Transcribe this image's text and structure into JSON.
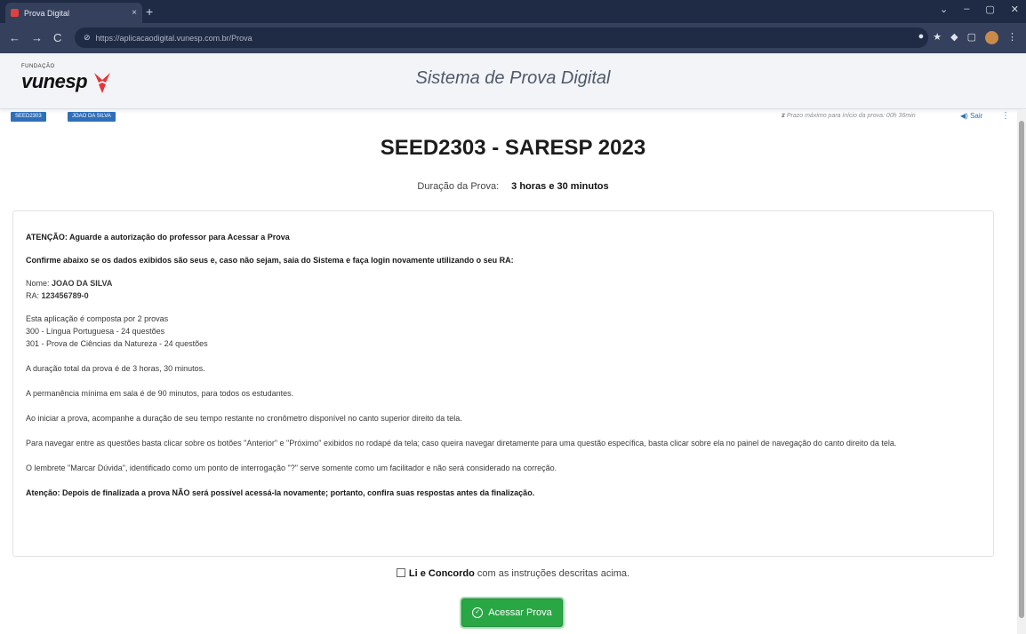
{
  "browser": {
    "tab_title": "Prova Digital",
    "tab_close": "×",
    "new_tab": "+",
    "window_controls": [
      "⌄",
      "–",
      "▢",
      "✕"
    ],
    "nav": [
      "←",
      "→",
      "C"
    ],
    "url": "https://aplicacaodigital.vunesp.com.br/Prova",
    "extensions": [
      "●",
      "★",
      "◆",
      "▢"
    ]
  },
  "header": {
    "logo_small": "FUNDAÇÃO",
    "logo_word": "vunesp",
    "title": "Sistema de Prova Digital"
  },
  "infostrip": {
    "code_badge": "SEED2303",
    "name_badge": "JOAO DA SILVA",
    "deadline_icon": "⧗",
    "deadline_text": "Prazo máximo para início da prova: 00h 36min",
    "logout_label": "Sair",
    "menu_icon": "⋮"
  },
  "main": {
    "exam_title": "SEED2303 - SARESP 2023",
    "duration_label": "Duração da Prova:",
    "duration_value": "3 horas e 30 minutos",
    "attention": "ATENÇÃO: Aguarde a autorização do professor para Acessar a Prova",
    "confirm": "Confirme abaixo se os dados exibidos são seus e, caso não sejam, saia do Sistema e faça login novamente utilizando o seu RA:",
    "name_label": "Nome:",
    "name_value": "JOAO DA SILVA",
    "ra_label": "RA:",
    "ra_value": "123456789-0",
    "composed": "Esta aplicação é composta por 2 provas",
    "test1": "300 - Língua Portuguesa - 24 questões",
    "test2": "301 - Prova de Ciências da Natureza - 24 questões",
    "total_duration": "A duração total da prova é de 3 horas, 30 minutos.",
    "min_stay": "A permanência mínima em sala é de 90 minutos, para todos os estudantes.",
    "timer_info": "Ao iniciar a prova, acompanhe a duração de seu tempo restante no cronômetro disponível no canto superior direito da tela.",
    "navigation_info": "Para navegar entre as questões basta clicar sobre os botões \"Anterior\" e \"Próximo\" exibidos no rodapé da tela; caso queira navegar diretamente para uma questão específica, basta clicar sobre ela no painel de navegação do canto direito da tela.",
    "doubt_info": "O lembrete \"Marcar Dúvida\", identificado como um ponto de interrogação \"?\" serve somente como um facilitador e não será considerado na correção.",
    "final_warning": "Atenção: Depois de finalizada a prova NÃO será possível acessá-la novamente; portanto, confira suas respostas antes da finalização.",
    "agree_bold": "Li e Concordo",
    "agree_rest": "com as instruções descritas acima.",
    "access_button": "Acessar Prova"
  }
}
